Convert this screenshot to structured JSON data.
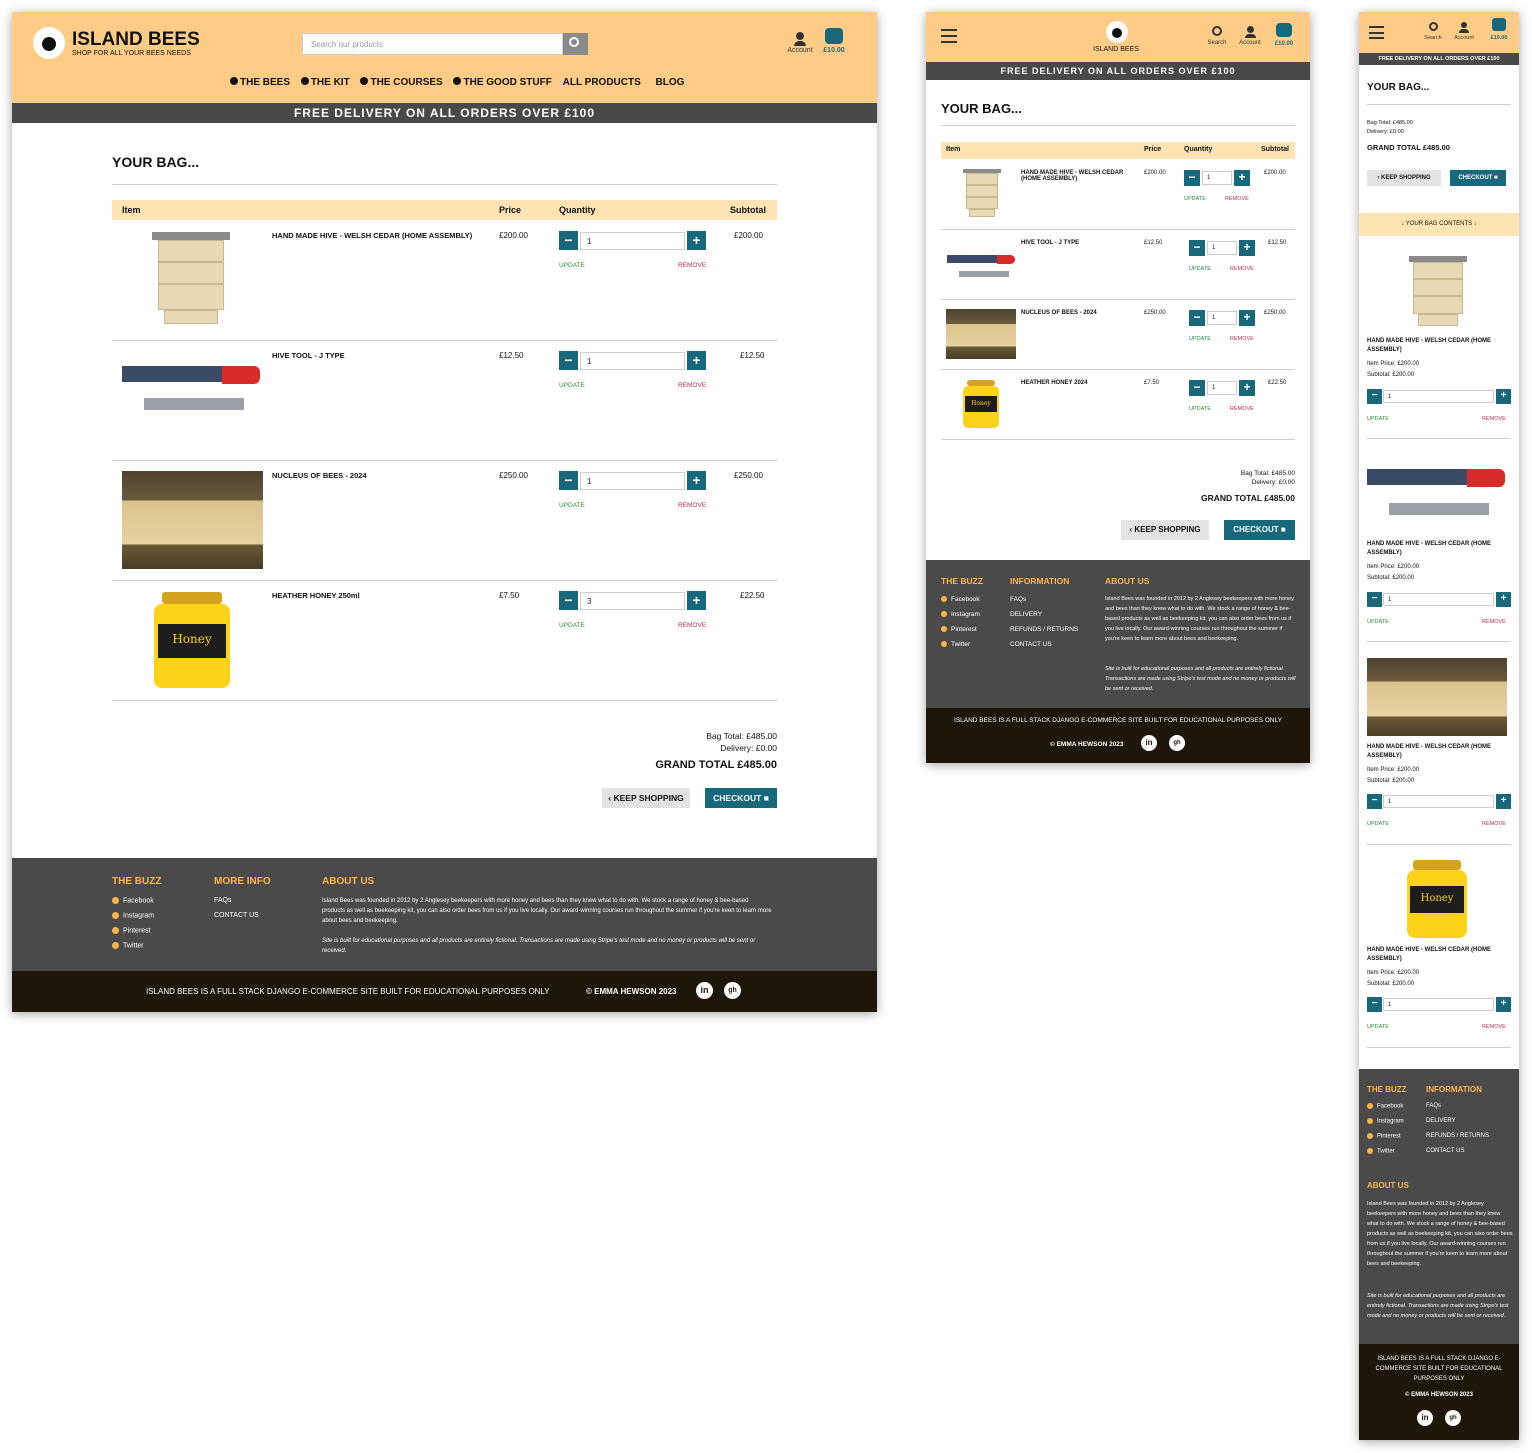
{
  "brand": {
    "name": "ISLAND BEES",
    "tagline": "SHOP FOR ALL YOUR BEES NEEDS"
  },
  "search": {
    "placeholder": "Search our products",
    "label": "Search"
  },
  "account": {
    "label": "Account"
  },
  "basket": {
    "amount": "£10.00"
  },
  "nav": [
    "THE BEES",
    "THE KIT",
    "THE COURSES",
    "THE GOOD STUFF",
    "ALL PRODUCTS",
    "BLOG"
  ],
  "banner": "FREE DELIVERY ON ALL ORDERS OVER £100",
  "bag": {
    "title": "YOUR BAG...",
    "columns": {
      "item": "Item",
      "price": "Price",
      "quantity": "Quantity",
      "subtotal": "Subtotal"
    },
    "update_label": "UPDATE",
    "remove_label": "REMOVE",
    "items_desktop": [
      {
        "name": "HAND MADE HIVE - WELSH CEDAR (HOME ASSEMBLY)",
        "price": "£200.00",
        "qty": "1",
        "subtotal": "£200.00"
      },
      {
        "name": "HIVE TOOL - J TYPE",
        "price": "£12.50",
        "qty": "1",
        "subtotal": "£12.50"
      },
      {
        "name": "NUCLEUS OF BEES - 2024",
        "price": "£250.00",
        "qty": "1",
        "subtotal": "£250.00"
      },
      {
        "name": "HEATHER HONEY 250ml",
        "price": "£7.50",
        "qty": "3",
        "subtotal": "£22.50"
      }
    ],
    "items_tablet": [
      {
        "name": "HAND MADE HIVE - WELSH CEDAR (HOME ASSEMBLY)",
        "price": "£200.00",
        "qty": "1",
        "subtotal": "£200.00"
      },
      {
        "name": "HIVE TOOL - J TYPE",
        "price": "£12.50",
        "qty": "1",
        "subtotal": "£12.50"
      },
      {
        "name": "NUCLEUS OF BEES - 2024",
        "price": "£250.00",
        "qty": "1",
        "subtotal": "£250.00"
      },
      {
        "name": "HEATHER HONEY 2024",
        "price": "£7.50",
        "qty": "1",
        "subtotal": "£22.50"
      }
    ],
    "items_mobile": [
      {
        "name": "HAND MADE HIVE - WELSH CEDAR (HOME ASSEMBLY)",
        "price": "Item Price: £200.00",
        "subtotal": "Subtotal: £200.00",
        "qty": "1"
      },
      {
        "name": "HAND MADE HIVE - WELSH CEDAR (HOME ASSEMBLY)",
        "price": "Item Price: £200.00",
        "subtotal": "Subtotal: £200.00",
        "qty": "1"
      },
      {
        "name": "HAND MADE HIVE - WELSH CEDAR (HOME ASSEMBLY)",
        "price": "Item Price: £200.00",
        "subtotal": "Subtotal: £200.00",
        "qty": "1"
      },
      {
        "name": "HAND MADE HIVE - WELSH CEDAR (HOME ASSEMBLY)",
        "price": "Item Price: £200.00",
        "subtotal": "Subtotal: £200.00",
        "qty": "1"
      }
    ],
    "bag_total": "Bag Total: £485.00",
    "delivery": "Delivery: £0.00",
    "grand_total": "GRAND TOTAL £485.00",
    "keep_shopping": "KEEP SHOPPING",
    "checkout": "CHECKOUT",
    "contents_toggle": "YOUR BAG CONTENTS"
  },
  "footer": {
    "buzz_title": "THE BUZZ",
    "social": [
      "Facebook",
      "Instagram",
      "Pinterest",
      "Twitter"
    ],
    "more_info_title": "MORE INFO",
    "information_title": "INFORMATION",
    "info_links_desktop": [
      "FAQs",
      "CONTACT US"
    ],
    "info_links_full": [
      "FAQs",
      "DELIVERY",
      "REFUNDS / RETURNS",
      "CONTACT US"
    ],
    "about_title": "ABOUT US",
    "about_text": "Island Bees was founded in 2012 by 2 Anglesey beekeepers with more honey and bees than they knew what to do with.  We stock a range of honey & bee-based products as well as beekeeping kit, you can also order bees from us if you live locally. Our award-winning courses run throughout the summer if you're keen to learn more about bees and beekeeping.",
    "disclaimer": "Site is built for educational purposes and all products are entirely fictional. Transactions are made using Stripe's test mode and no money or products will be sent or received.",
    "bottom_text": "ISLAND BEES IS A FULL STACK DJANGO E-COMMERCE SITE BUILT FOR EDUCATIONAL PURPOSES ONLY",
    "copyright": "© EMMA HEWSON 2023",
    "linkedin": "in",
    "github": "gh"
  },
  "colors": {
    "header": "#ffcc88",
    "banner": "#494949",
    "accent": "#17687a",
    "footer": "#4a4a4a",
    "footer_bottom": "#1d1609"
  }
}
